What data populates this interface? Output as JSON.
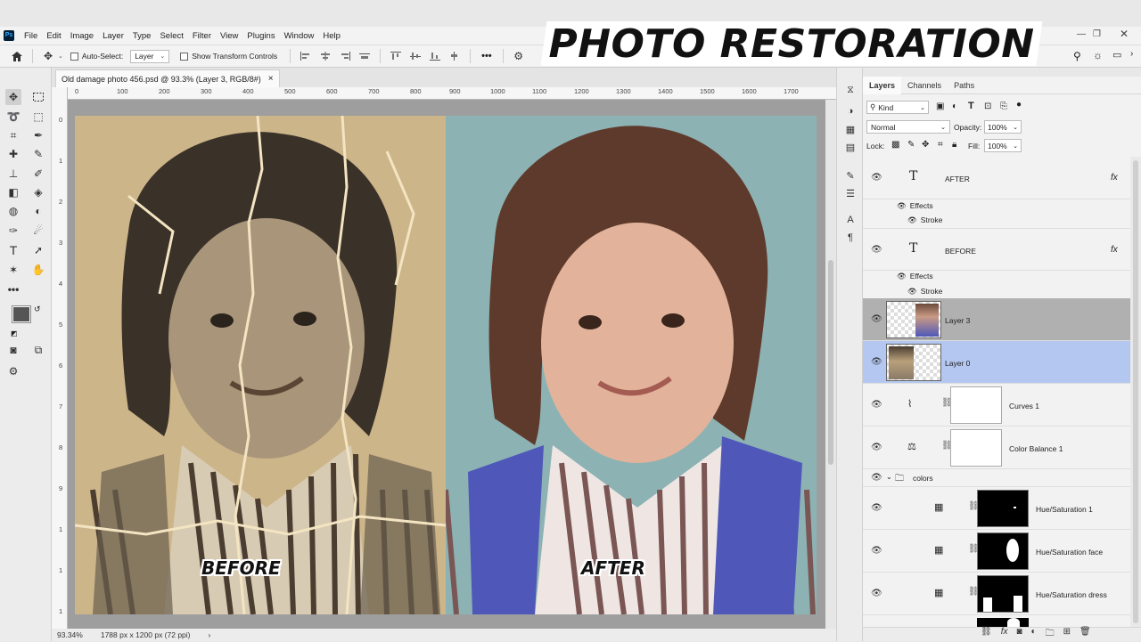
{
  "banner": {
    "title": "PHOTO RESTORATION"
  },
  "menu": [
    "File",
    "Edit",
    "Image",
    "Layer",
    "Type",
    "Select",
    "Filter",
    "View",
    "Plugins",
    "Window",
    "Help"
  ],
  "options": {
    "auto_select_label": "Auto-Select:",
    "auto_select_value": "Layer",
    "show_transform_label": "Show Transform Controls",
    "more_label": "•••"
  },
  "document": {
    "tab_title": "Old damage photo 456.psd @ 93.3% (Layer 3, RGB/8#)",
    "close": "×"
  },
  "rulers": {
    "top": [
      "0",
      "100",
      "200",
      "300",
      "400",
      "500",
      "600",
      "700",
      "800",
      "900",
      "1000",
      "1100",
      "1200",
      "1300",
      "1400",
      "1500",
      "1600",
      "1700"
    ],
    "left": [
      "0",
      "1",
      "2",
      "3",
      "4",
      "5",
      "6",
      "7",
      "8",
      "9",
      "1",
      "1",
      "1"
    ]
  },
  "canvas": {
    "before_label": "BEFORE",
    "after_label": "AFTER"
  },
  "status": {
    "zoom": "93.34%",
    "doc_info": "1788 px x 1200 px (72 ppi)",
    "arrow": "›"
  },
  "panel": {
    "tabs": [
      "Layers",
      "Channels",
      "Paths"
    ],
    "kind_label": "Kind",
    "blend_mode": "Normal",
    "opacity_label": "Opacity:",
    "opacity_value": "100%",
    "lock_label": "Lock:",
    "fill_label": "Fill:",
    "fill_value": "100%"
  },
  "layers": [
    {
      "name": "AFTER",
      "type": "text",
      "fx": "fx"
    },
    {
      "name": "Effects",
      "type": "effects"
    },
    {
      "name": "Stroke",
      "type": "effect-item"
    },
    {
      "name": "BEFORE",
      "type": "text",
      "fx": "fx"
    },
    {
      "name": "Effects",
      "type": "effects"
    },
    {
      "name": "Stroke",
      "type": "effect-item"
    },
    {
      "name": "Layer 3",
      "type": "pixel",
      "selected": "gray"
    },
    {
      "name": "Layer 0",
      "type": "pixel",
      "selected": "blue"
    },
    {
      "name": "Curves 1",
      "type": "adjustment"
    },
    {
      "name": "Color Balance 1",
      "type": "adjustment"
    },
    {
      "name": "colors",
      "type": "group"
    },
    {
      "name": "Hue/Saturation 1",
      "type": "adjustment-mask"
    },
    {
      "name": "Hue/Saturation face",
      "type": "adjustment-mask"
    },
    {
      "name": "Hue/Saturation dress",
      "type": "adjustment-mask"
    }
  ],
  "colors": {
    "selected_blue": "#b3c7f0",
    "selected_gray": "#b0b0b0",
    "dress_blue": "#4f58b8"
  }
}
